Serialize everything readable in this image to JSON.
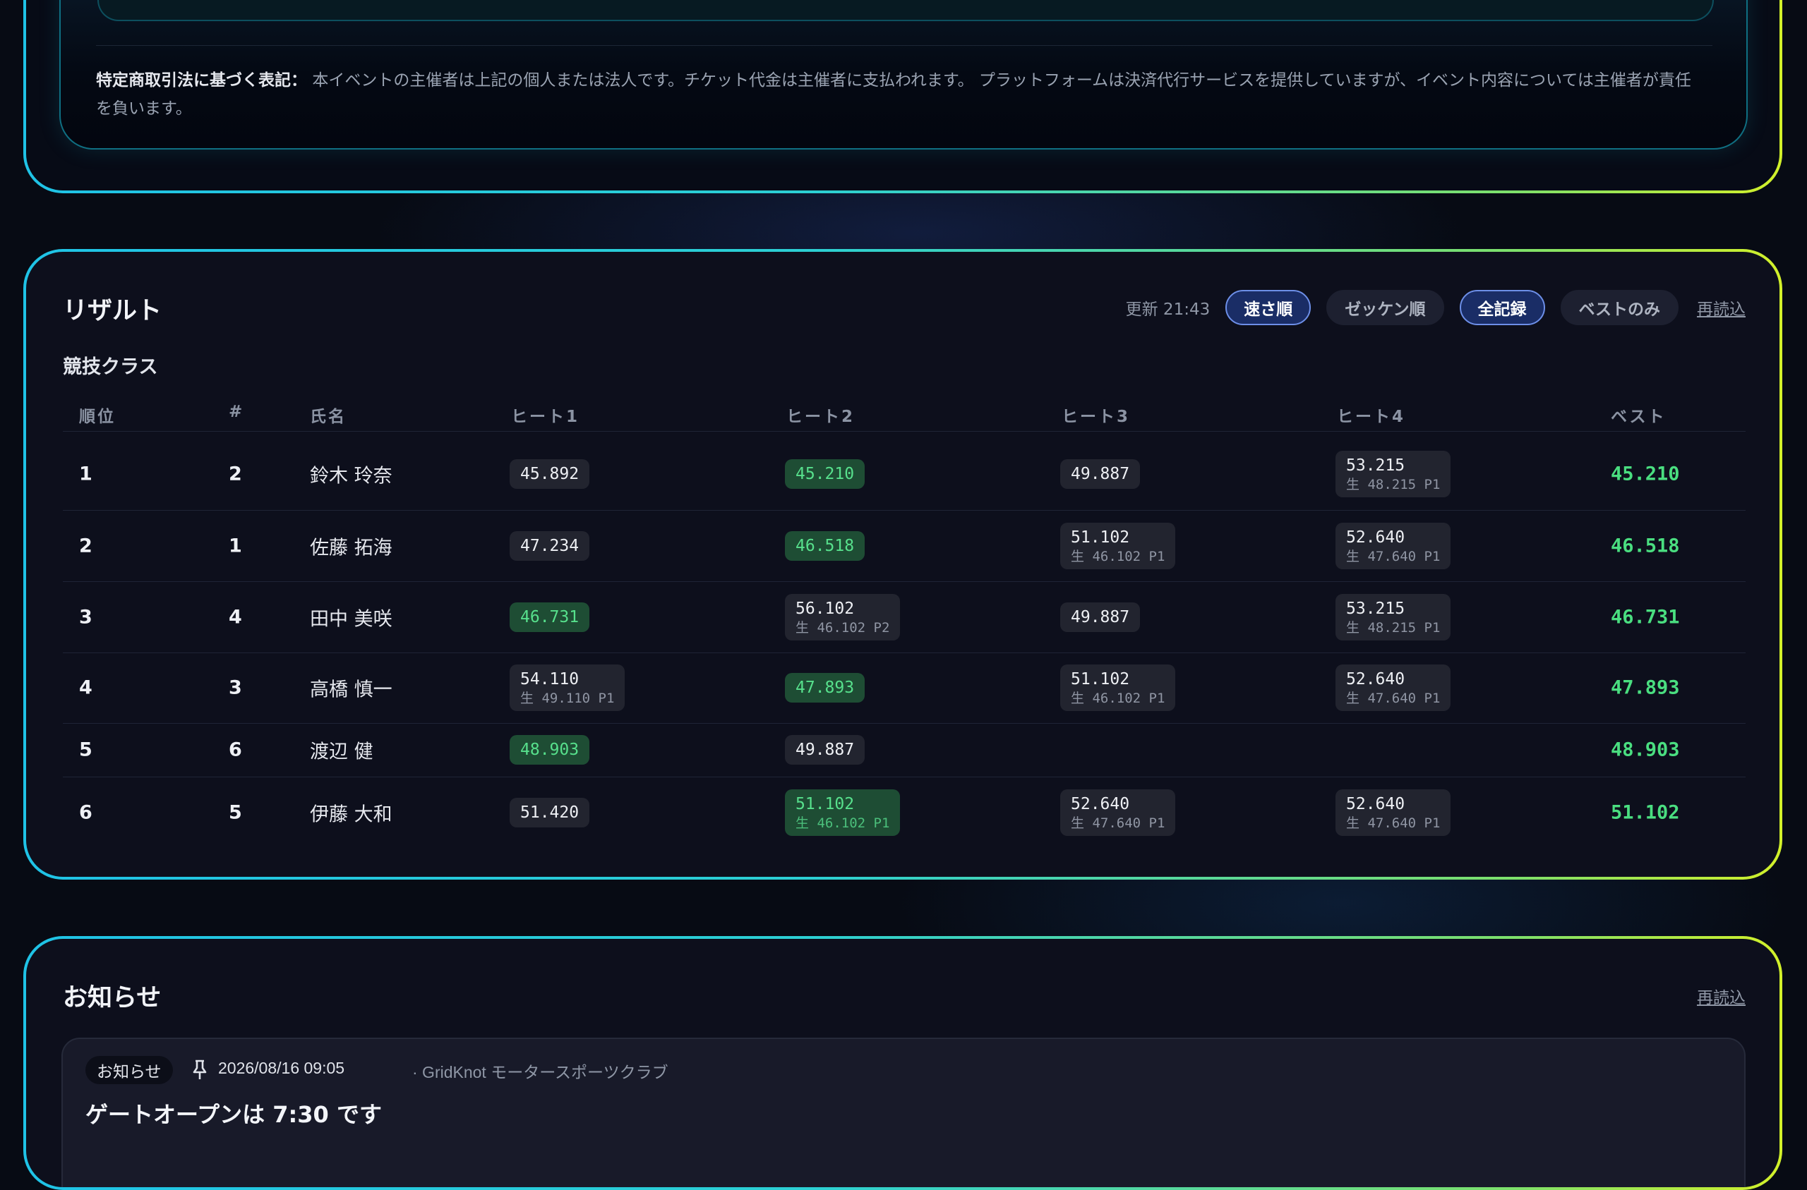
{
  "legal": {
    "label": "特定商取引法に基づく表記：",
    "text": "本イベントの主催者は上記の個人または法人です。チケット代金は主催者に支払われます。 プラットフォームは決済代行サービスを提供していますが、イベント内容については主催者が責任を負います。"
  },
  "results": {
    "title": "リザルト",
    "updated": "更新 21:43",
    "filters": [
      {
        "label": "速さ順",
        "active": true
      },
      {
        "label": "ゼッケン順",
        "active": false
      },
      {
        "label": "全記録",
        "active": true
      },
      {
        "label": "ベストのみ",
        "active": false
      }
    ],
    "reload": "再読込",
    "class_name": "競技クラス",
    "columns": [
      "順位",
      "#",
      "氏名",
      "ヒート1",
      "ヒート2",
      "ヒート3",
      "ヒート4",
      "ベスト"
    ],
    "rows": [
      {
        "rank": "1",
        "num": "2",
        "name": "鈴木 玲奈",
        "heats": [
          {
            "time": "45.892"
          },
          {
            "time": "45.210",
            "best": true
          },
          {
            "time": "49.887"
          },
          {
            "time": "53.215",
            "raw": "生 48.215 P1"
          }
        ],
        "best": "45.210"
      },
      {
        "rank": "2",
        "num": "1",
        "name": "佐藤 拓海",
        "heats": [
          {
            "time": "47.234"
          },
          {
            "time": "46.518",
            "best": true
          },
          {
            "time": "51.102",
            "raw": "生 46.102 P1"
          },
          {
            "time": "52.640",
            "raw": "生 47.640 P1"
          }
        ],
        "best": "46.518"
      },
      {
        "rank": "3",
        "num": "4",
        "name": "田中 美咲",
        "heats": [
          {
            "time": "46.731",
            "best": true
          },
          {
            "time": "56.102",
            "raw": "生 46.102 P2"
          },
          {
            "time": "49.887"
          },
          {
            "time": "53.215",
            "raw": "生 48.215 P1"
          }
        ],
        "best": "46.731"
      },
      {
        "rank": "4",
        "num": "3",
        "name": "高橋 慎一",
        "heats": [
          {
            "time": "54.110",
            "raw": "生 49.110 P1"
          },
          {
            "time": "47.893",
            "best": true
          },
          {
            "time": "51.102",
            "raw": "生 46.102 P1"
          },
          {
            "time": "52.640",
            "raw": "生 47.640 P1"
          }
        ],
        "best": "47.893"
      },
      {
        "rank": "5",
        "num": "6",
        "name": "渡辺 健",
        "heats": [
          {
            "time": "48.903",
            "best": true
          },
          {
            "time": "49.887"
          },
          null,
          null
        ],
        "best": "48.903"
      },
      {
        "rank": "6",
        "num": "5",
        "name": "伊藤 大和",
        "heats": [
          {
            "time": "51.420"
          },
          {
            "time": "51.102",
            "raw": "生 46.102 P1",
            "best": true
          },
          {
            "time": "52.640",
            "raw": "生 47.640 P1"
          },
          {
            "time": "52.640",
            "raw": "生 47.640 P1"
          }
        ],
        "best": "51.102"
      }
    ]
  },
  "notices": {
    "title": "お知らせ",
    "reload": "再読込",
    "item": {
      "tag": "お知らせ",
      "icon": "pin-icon",
      "date": "2026/08/16 09:05",
      "org": "· GridKnot モータースポーツクラブ",
      "headline": "ゲートオープンは 7:30 です"
    }
  }
}
